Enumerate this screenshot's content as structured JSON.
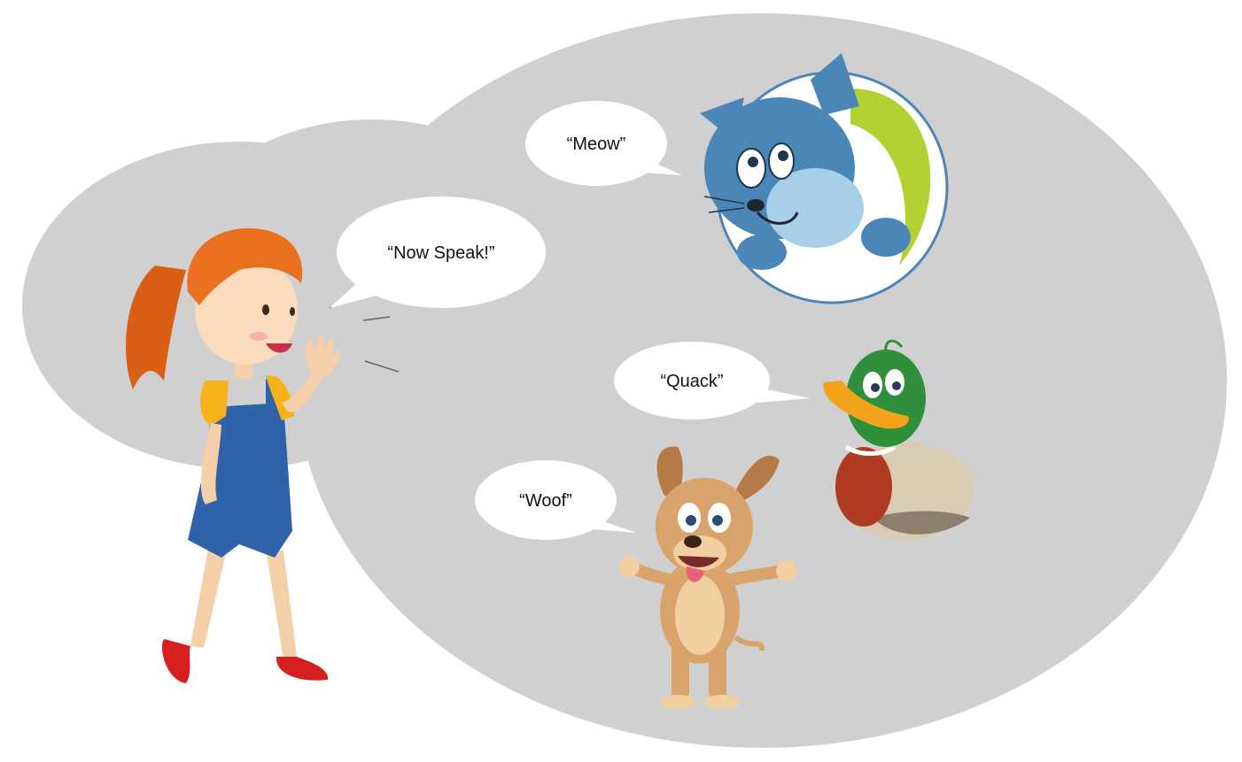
{
  "bubbles": {
    "girl": "“Now Speak!”",
    "cat": "“Meow”",
    "duck": "“Quack”",
    "dog": "“Woof”"
  },
  "characters": {
    "girl": "girl-illustration",
    "cat": "cat-illustration",
    "duck": "duck-illustration",
    "dog": "dog-illustration"
  },
  "colors": {
    "background_blob": "#d0d0d0",
    "bubble_fill": "#ffffff",
    "girl_hair": "#e8701e",
    "overalls": "#2f62a8",
    "shirt": "#f7b21a",
    "shoes": "#d62020",
    "cat_fur": "#4a86b8",
    "cat_badge_accent": "#b4d134",
    "duck_head": "#2f8f3a",
    "duck_beak": "#f2a31a",
    "dog_fur": "#d9a36c"
  }
}
